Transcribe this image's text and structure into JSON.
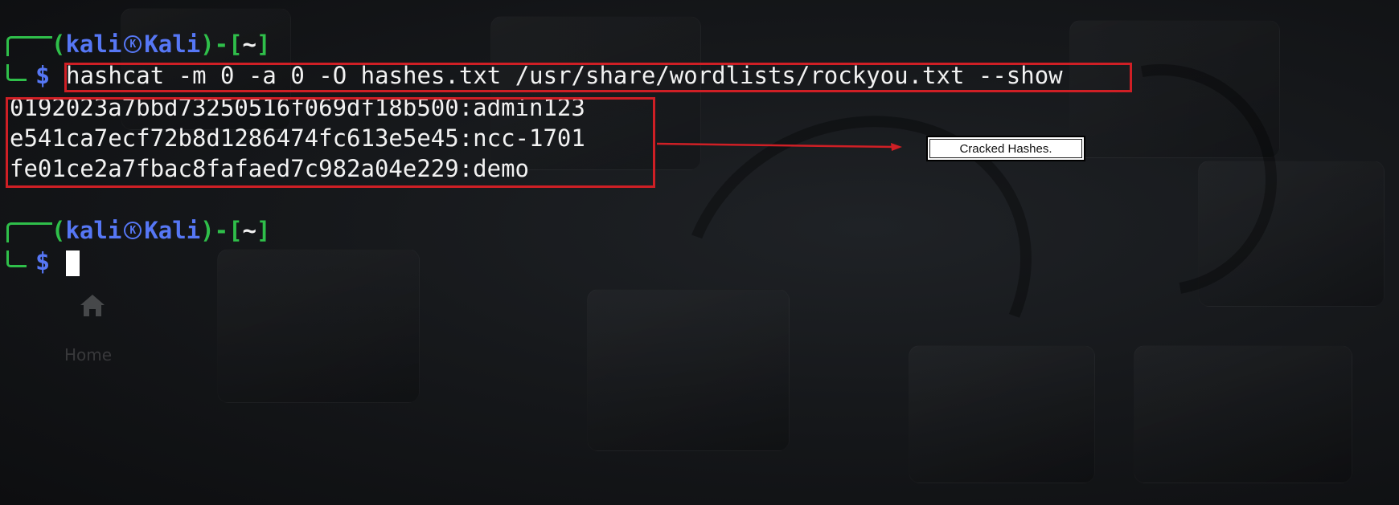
{
  "wallpaper": {
    "ghost_icon": "home-icon",
    "ghost_label": "Home"
  },
  "prompts": [
    {
      "user": "kali",
      "host": "Kali",
      "cwd": "~",
      "symbol": "dollar-sign",
      "command": "hashcat -m 0 -a 0 -O hashes.txt /usr/share/wordlists/rockyou.txt --show"
    },
    {
      "user": "kali",
      "host": "Kali",
      "cwd": "~",
      "symbol": "dollar-sign",
      "command": ""
    }
  ],
  "output": [
    "0192023a7bbd73250516f069df18b500:admin123",
    "e541ca7ecf72b8d1286474fc613e5e45:ncc-1701",
    "fe01ce2a7fbac8fafaed7c982a04e229:demo"
  ],
  "annotation": {
    "label": "Cracked Hashes.",
    "highlight_color": "#cf1f25"
  },
  "colors": {
    "prompt_green": "#2fbf4a",
    "prompt_blue": "#5677f5",
    "text": "#f2f2f2",
    "background": "#16181b"
  }
}
